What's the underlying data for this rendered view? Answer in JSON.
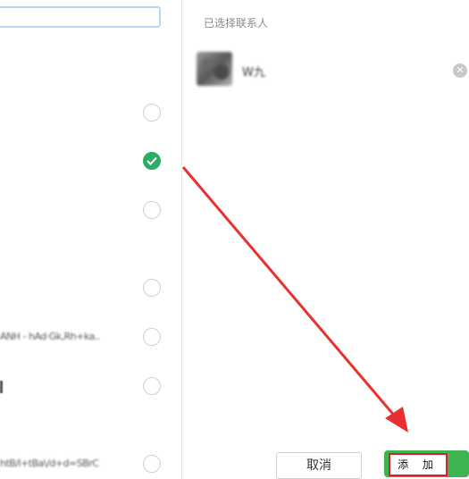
{
  "search": {
    "placeholder": ""
  },
  "contacts_list": [
    {
      "name": "",
      "checked": false,
      "bar": false
    },
    {
      "name": "",
      "checked": true,
      "bar": false
    },
    {
      "name": "",
      "checked": false,
      "bar": false
    },
    {
      "name": "",
      "checked": false,
      "bar": false
    },
    {
      "name": "",
      "checked": false,
      "bar": false
    },
    {
      "name": "ANH - hAd·Gk,Rh+ka..",
      "checked": false,
      "bar": false
    },
    {
      "name": "",
      "checked": false,
      "bar": true
    },
    {
      "name": "",
      "checked": false,
      "bar": false
    },
    {
      "name": "htB/l+tBa\\/d+d=SBrC",
      "checked": false,
      "bar": false
    }
  ],
  "selected_panel": {
    "title": "已选择联系人",
    "contact": {
      "name": "W九"
    },
    "remove_icon": "close-circle-icon"
  },
  "buttons": {
    "cancel": "取消",
    "add": "添 加"
  },
  "colors": {
    "accent_green": "#3fb34f",
    "check_green": "#2aae67",
    "highlight_red": "#d4232a",
    "arrow_red": "#e8312f"
  }
}
